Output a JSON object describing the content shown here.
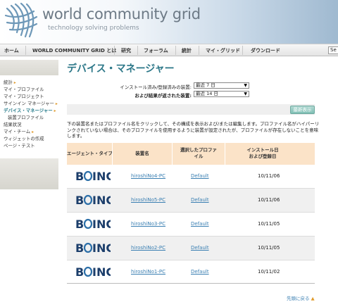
{
  "header": {
    "title": "world community grid",
    "tagline": "technology solving problems"
  },
  "nav": {
    "items": [
      "ホーム",
      "WORLD COMMUNITY GRID とは",
      "研究",
      "フォーラム",
      "統計",
      "マイ・グリッド",
      "ダウンロード"
    ],
    "search_placeholder": "Se"
  },
  "sidebar": {
    "items": [
      {
        "label": "統計",
        "arrow": "▸"
      },
      {
        "label": "マイ・プロファイル",
        "arrow": ""
      },
      {
        "label": "マイ・プロジェクト",
        "arrow": ""
      },
      {
        "label": "サインイン マネージャー",
        "arrow": "▸"
      },
      {
        "label": "デバイス・マネージャー",
        "arrow": "▸"
      },
      {
        "label": "装置プロファイル",
        "arrow": ""
      },
      {
        "label": "結果状況",
        "arrow": ""
      },
      {
        "label": "マイ・チーム",
        "arrow": "▸"
      },
      {
        "label": "ウィジェットの作成",
        "arrow": ""
      },
      {
        "label": "ページ・テスト",
        "arrow": ""
      }
    ]
  },
  "main": {
    "title": "デバイス・マネージャー",
    "filter1_label": "インストール済み/登録済みの装置:",
    "filter1_value": "最近 7 日",
    "filter2_label": "および結果が返された装置:",
    "filter2_value": "最近 14 日",
    "update_button": "最新表示",
    "description": "下の装置名またはプロファイル名をクリックして、その構成を表示および/または編集します。プロファイル名がハイパーリンクされていない場合は、そのプロファイルを使用するように装置が設定されたが、プロファイルが存在しないことを意味します。",
    "table": {
      "headers": {
        "agent_type": "エージェント・タイプ",
        "device_name": "装置名",
        "profile_line1": "選択したプロファ",
        "profile_line2": "イル",
        "date_line1": "インストール日",
        "date_line2": "および登録日"
      },
      "rows": [
        {
          "agent": "BOINC",
          "device": "hiroshiNo4-PC",
          "profile": "Default",
          "date": "10/11/06"
        },
        {
          "agent": "BOINC",
          "device": "hiroshiNo5-PC",
          "profile": "Default",
          "date": "10/11/06"
        },
        {
          "agent": "BOINC",
          "device": "hiroshiNo3-PC",
          "profile": "Default",
          "date": "10/11/05"
        },
        {
          "agent": "BOINC",
          "device": "hiroshiNo2-PC",
          "profile": "Default",
          "date": "10/11/05"
        },
        {
          "agent": "BOINC",
          "device": "hiroshiNo1-PC",
          "profile": "Default",
          "date": "10/11/02"
        }
      ]
    },
    "back_to_top": "先頭に戻る",
    "back_to_top_arrow": "▲"
  },
  "colors": {
    "accent": "#2c7788",
    "link": "#3a7fb2",
    "table_header": "#fbe3c8",
    "arrow": "#e09a2a"
  },
  "icons": {
    "logo": "world-community-grid-logo-icon",
    "agent": "boinc-logo-icon",
    "up": "up-arrow-icon"
  }
}
